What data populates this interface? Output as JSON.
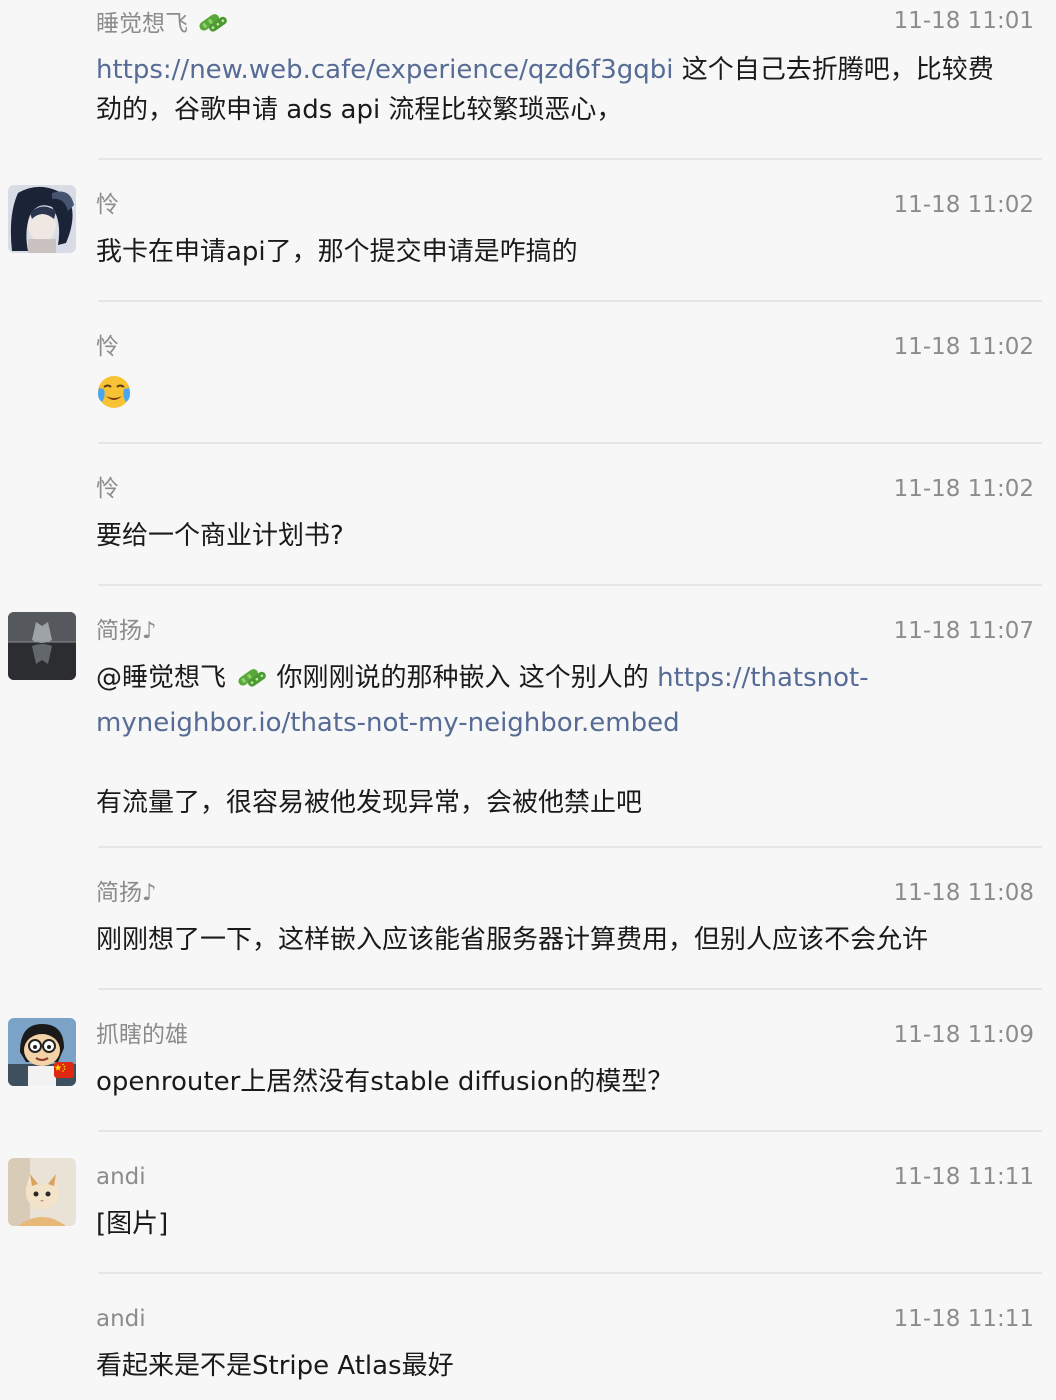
{
  "messages": [
    {
      "sender": "睡觉想飞",
      "time": "11-18 11:01",
      "link": "https://new.web.cafe/experience/qzd6f3gqbi",
      "text_line1": " 这个自己去折腾吧，比较费",
      "text_line2": "劲的，谷歌申请 ads api 流程比较繁琐恶心，"
    },
    {
      "sender": "怜",
      "time": "11-18 11:02",
      "text": "我卡在申请api了，那个提交申请是咋搞的"
    },
    {
      "sender": "怜",
      "time": "11-18 11:02",
      "emoji": "😭"
    },
    {
      "sender": "怜",
      "time": "11-18 11:02",
      "text": "要给一个商业计划书?"
    },
    {
      "sender": "简扬♪",
      "time": "11-18 11:07",
      "mention": "@睡觉想飞",
      "text_a": " 你刚刚说的那种嵌入 这个别人的  ",
      "link_a": "https://thatsnot-",
      "link_b": "myneighbor.io/thats-not-my-neighbor.embed",
      "text_b": "有流量了，很容易被他发现异常，会被他禁止吧"
    },
    {
      "sender": "简扬♪",
      "time": "11-18 11:08",
      "text": "刚刚想了一下，这样嵌入应该能省服务器计算费用，但别人应该不会允许"
    },
    {
      "sender": "抓瞎的雄",
      "time": "11-18 11:09",
      "text": "openrouter上居然没有stable diffusion的模型？"
    },
    {
      "sender": "andi",
      "time": "11-18 11:11",
      "text": "[图片]"
    },
    {
      "sender": "andi",
      "time": "11-18 11:11",
      "text": "看起来是不是Stripe Atlas最好"
    }
  ],
  "icons": {
    "sender_badge": "cucumber-icon",
    "flag_badge": "china-flag-icon",
    "emoji": "crying-face-icon"
  },
  "colors": {
    "background": "#f7f7f7",
    "link": "#566b95",
    "meta_text": "#8c8c8c",
    "body_text": "#1a1a1a",
    "separator": "#e6e6e6"
  }
}
